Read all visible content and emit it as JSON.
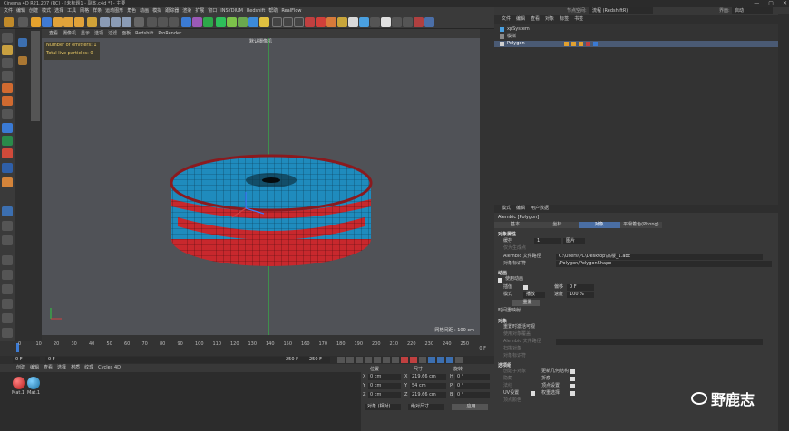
{
  "window": {
    "title": "Cinema 4D R21.207 (RC) - [未标题1 - 副本.c4d *] - 主要",
    "buttons": [
      "—",
      "▢",
      "✕"
    ]
  },
  "menu": [
    "文件",
    "编辑",
    "创建",
    "模式",
    "选择",
    "工具",
    "网格",
    "样条",
    "运动图形",
    "角色",
    "动画",
    "模拟",
    "跟踪器",
    "渲染",
    "扩展",
    "窗口",
    "INSYDIUM",
    "Redshift",
    "帮助",
    "RealFlow"
  ],
  "viewport": {
    "menu": [
      "查看",
      "摄像机",
      "显示",
      "选项",
      "过滤",
      "面板",
      "Redshift",
      "ProRender"
    ],
    "camera_label": "默认摄像机",
    "hud": {
      "vertices": "Number of emitters: 1",
      "particles": "Total live particles: 0"
    },
    "grid_spacing": "网格间距 : 100 cm",
    "colors": {
      "blue": "#1f8bbd",
      "red": "#c8282d",
      "bg": "#505257",
      "axis_green": "#2ecc40",
      "axis_blue": "#3c7bff"
    }
  },
  "timeline": {
    "ticks": [
      "0",
      "10",
      "20",
      "30",
      "40",
      "50",
      "60",
      "70",
      "80",
      "90",
      "100",
      "110",
      "120",
      "130",
      "140",
      "150",
      "160",
      "170",
      "180",
      "190",
      "200",
      "210",
      "220",
      "230",
      "240",
      "250"
    ],
    "frame_end": "0 F"
  },
  "transport": {
    "start": "0 F",
    "cur": "0 F",
    "end_a": "250 F",
    "end_b": "250 F"
  },
  "material": {
    "menu": [
      "创建",
      "编辑",
      "查看",
      "选择",
      "材质",
      "纹理",
      "Cycles 4D"
    ],
    "items": [
      "Mat.1",
      "Mat.1"
    ]
  },
  "coords": {
    "headers": [
      "位置",
      "尺寸",
      "旋转"
    ],
    "rows": [
      {
        "a": "X",
        "v1": "0 cm",
        "b": "X",
        "v2": "219.66 cm",
        "c": "H",
        "v3": "0 °"
      },
      {
        "a": "Y",
        "v1": "0 cm",
        "b": "Y",
        "v2": "54 cm",
        "c": "P",
        "v3": "0 °"
      },
      {
        "a": "Z",
        "v1": "0 cm",
        "b": "Z",
        "v2": "219.66 cm",
        "c": "B",
        "v3": "0 °"
      }
    ],
    "mode1": "对象 (相对)",
    "mode2": "绝对尺寸",
    "apply": "应用"
  },
  "right": {
    "top": {
      "layout_label": "节点空间:",
      "layout_value": "流程 (RedshiftR)",
      "interface_label": "界面:",
      "interface_value": "启动"
    },
    "objmenu": [
      "文件",
      "编辑",
      "查看",
      "对象",
      "标签",
      "书签"
    ],
    "objects": [
      "xpSystem",
      "模拟",
      "Polygon"
    ],
    "attrmenu": [
      "模式",
      "编辑",
      "用户数据"
    ],
    "attr_title": "Alembic [Polygon]",
    "tabs": [
      "基本",
      "坐标",
      "对象",
      "平滑着色(Phong)"
    ],
    "section_obj": "对象属性",
    "labels": {
      "cache": "缓存",
      "cache_val": "1",
      "cache_unit": "图片",
      "gen_points": "仅为生成点",
      "path_label": "Alembic 文件路径",
      "path": "C:\\Users\\PC\\Desktop\\高楼_1.abc",
      "identifier_label": "对象标识符",
      "identifier": "/Polygon/PolygonShape",
      "anim": "动画",
      "anim_use": "使用动画",
      "interp": "插值",
      "offset": "偏移",
      "offset_val": "0 F",
      "mode": "模式",
      "mode_val": "播放",
      "speed": "速度",
      "speed_val": "100 %",
      "reset": "重置",
      "manual": "手动",
      "time_mapping": "时间重映射",
      "section_attrs": "对象",
      "ui_visibility": "重置时激活可视",
      "override": "使用对象覆盖",
      "alembic_path2": "Alembic 文件路径",
      "scan": "扫描对象",
      "obj_id": "对象标识符",
      "section_geo": "选项组",
      "children": "创建子对象",
      "hide": "隐藏",
      "normals": "法线",
      "uv": "UV设置",
      "vert_colors": "顶点颜色",
      "mat_sel": "材质选择",
      "tags": "标签",
      "subd": "细分",
      "update": "更新几何结构",
      "crease": "折痕",
      "vertex": "顶点设置",
      "weight": "权重选择"
    }
  },
  "watermark": "野鹿志"
}
